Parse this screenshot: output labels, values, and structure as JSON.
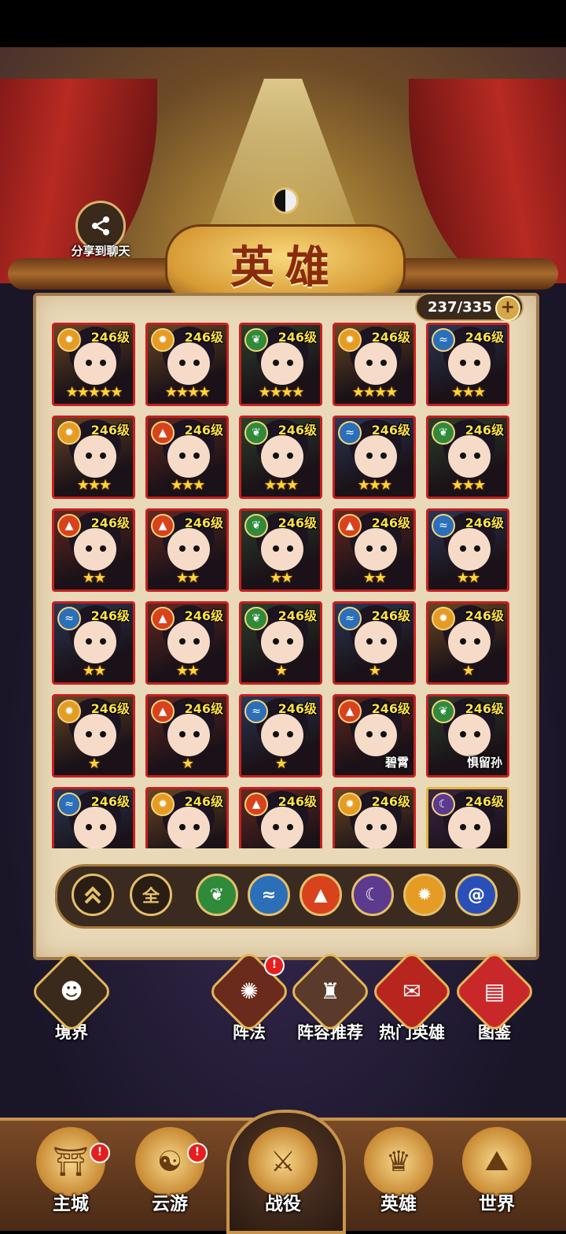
{
  "header": {
    "share_label": "分享到聊天",
    "title": "英雄"
  },
  "collection": {
    "count": "237/335"
  },
  "heroes": [
    {
      "level": "246级",
      "element": "light",
      "stars": 5,
      "name": ""
    },
    {
      "level": "246级",
      "element": "light",
      "stars": 4,
      "name": ""
    },
    {
      "level": "246级",
      "element": "wood",
      "stars": 4,
      "name": ""
    },
    {
      "level": "246级",
      "element": "light",
      "stars": 4,
      "name": ""
    },
    {
      "level": "246级",
      "element": "water",
      "stars": 3,
      "name": ""
    },
    {
      "level": "246级",
      "element": "light",
      "stars": 3,
      "name": ""
    },
    {
      "level": "246级",
      "element": "fire",
      "stars": 3,
      "name": ""
    },
    {
      "level": "246级",
      "element": "wood",
      "stars": 3,
      "name": ""
    },
    {
      "level": "246级",
      "element": "water",
      "stars": 3,
      "name": ""
    },
    {
      "level": "246级",
      "element": "wood",
      "stars": 3,
      "name": ""
    },
    {
      "level": "246级",
      "element": "fire",
      "stars": 2,
      "name": ""
    },
    {
      "level": "246级",
      "element": "fire",
      "stars": 2,
      "name": ""
    },
    {
      "level": "246级",
      "element": "wood",
      "stars": 2,
      "name": ""
    },
    {
      "level": "246级",
      "element": "fire",
      "stars": 2,
      "name": ""
    },
    {
      "level": "246级",
      "element": "water",
      "stars": 2,
      "name": ""
    },
    {
      "level": "246级",
      "element": "water",
      "stars": 2,
      "name": ""
    },
    {
      "level": "246级",
      "element": "fire",
      "stars": 2,
      "name": ""
    },
    {
      "level": "246级",
      "element": "wood",
      "stars": 1,
      "name": ""
    },
    {
      "level": "246级",
      "element": "water",
      "stars": 1,
      "name": ""
    },
    {
      "level": "246级",
      "element": "light",
      "stars": 1,
      "name": ""
    },
    {
      "level": "246级",
      "element": "light",
      "stars": 1,
      "name": ""
    },
    {
      "level": "246级",
      "element": "fire",
      "stars": 1,
      "name": ""
    },
    {
      "level": "246级",
      "element": "water",
      "stars": 1,
      "name": ""
    },
    {
      "level": "246级",
      "element": "fire",
      "stars": 0,
      "name": "碧霄"
    },
    {
      "level": "246级",
      "element": "wood",
      "stars": 0,
      "name": "惧留孙"
    },
    {
      "level": "246级",
      "element": "water",
      "stars": 0,
      "name": ""
    },
    {
      "level": "246级",
      "element": "light",
      "stars": 0,
      "name": ""
    },
    {
      "level": "246级",
      "element": "fire",
      "stars": 0,
      "name": ""
    },
    {
      "level": "246级",
      "element": "light",
      "stars": 0,
      "name": ""
    },
    {
      "level": "246级",
      "element": "dark",
      "stars": 0,
      "name": ""
    }
  ],
  "filters": {
    "all_label": "全",
    "elements": [
      "wood",
      "water",
      "fire",
      "dark",
      "light",
      "vortex"
    ]
  },
  "side_menu": {
    "realm_label": "境界",
    "formation_label": "阵法",
    "lineup_label": "阵容推荐",
    "hot_heroes_label": "热门英雄",
    "codex_label": "图鉴"
  },
  "bottom_nav": {
    "city_label": "主城",
    "travel_label": "云游",
    "battle_label": "战役",
    "hero_label": "英雄",
    "world_label": "世界"
  },
  "badges": {
    "alert": "!"
  },
  "colors": {
    "wood": "#2f8a3a",
    "water": "#2a6fb8",
    "fire": "#d8421c",
    "dark": "#5c3a8e",
    "light": "#e49c24"
  }
}
